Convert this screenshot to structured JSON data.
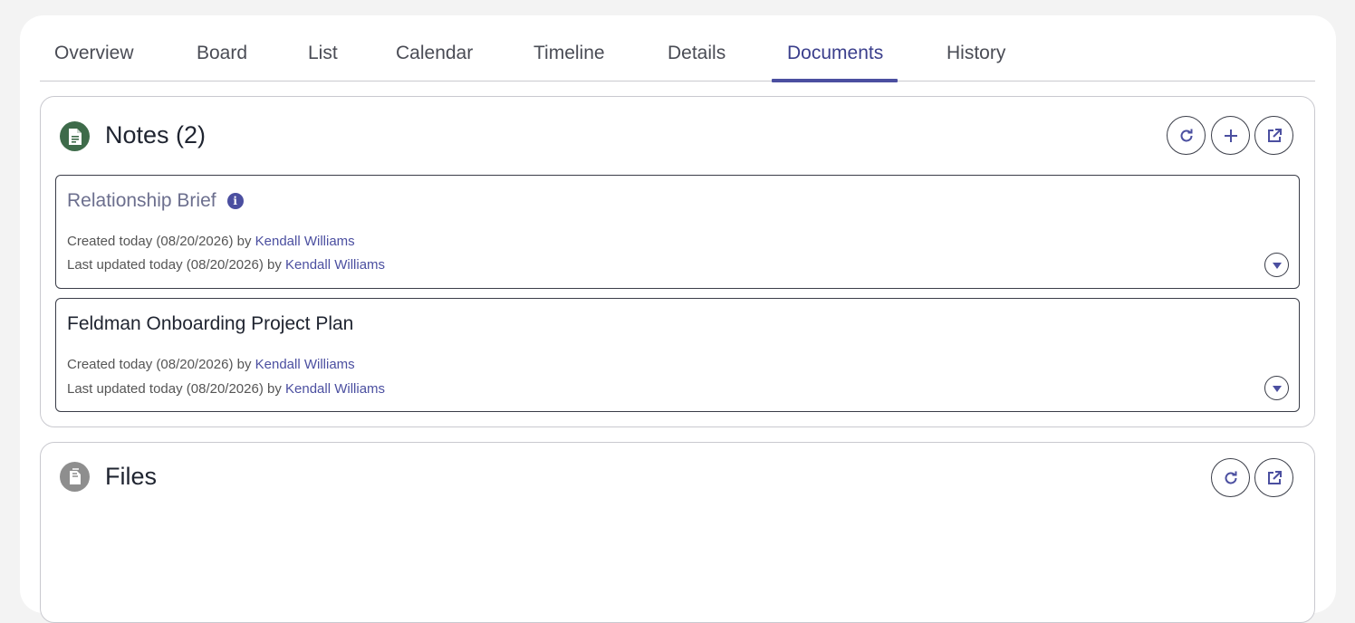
{
  "tabs": [
    {
      "label": "Overview"
    },
    {
      "label": "Board"
    },
    {
      "label": "List"
    },
    {
      "label": "Calendar"
    },
    {
      "label": "Timeline"
    },
    {
      "label": "Details"
    },
    {
      "label": "Documents",
      "active": true
    },
    {
      "label": "History"
    }
  ],
  "notes_panel": {
    "title": "Notes (2)",
    "icon": "note-document-icon",
    "actions": [
      "refresh-icon",
      "add-icon",
      "open-external-icon"
    ],
    "items": [
      {
        "title": "Relationship Brief",
        "has_info": true,
        "created_prefix": "Created today (08/20/2026) by",
        "created_by": "Kendall Williams",
        "updated_prefix": "Last updated today (08/20/2026) by",
        "updated_by": "Kendall Williams"
      },
      {
        "title": "Feldman Onboarding Project Plan",
        "has_info": false,
        "created_prefix": "Created today (08/20/2026) by",
        "created_by": "Kendall Williams",
        "updated_prefix": "Last updated today (08/20/2026) by",
        "updated_by": "Kendall Williams"
      }
    ]
  },
  "files_panel": {
    "title": "Files",
    "icon": "files-copy-icon",
    "actions": [
      "refresh-icon",
      "open-external-icon"
    ]
  },
  "colors": {
    "accent": "#4b4fa0",
    "notes_icon_bg": "#3e6b4a",
    "files_icon_bg": "#8e8e8e",
    "page_bg": "#f3f3f3"
  }
}
